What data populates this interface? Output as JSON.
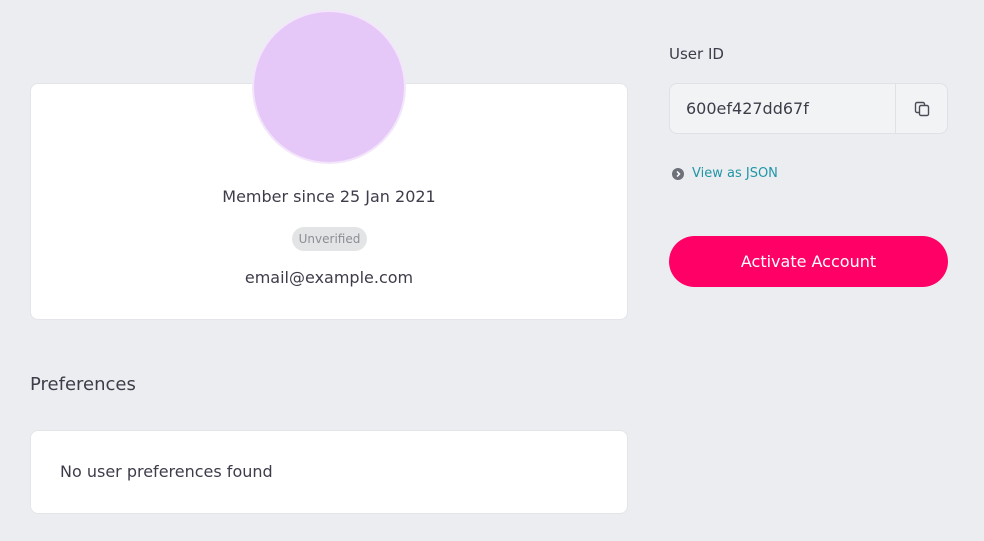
{
  "profile": {
    "member_since": "Member since 25 Jan 2021",
    "status_badge": "Unverified",
    "email": "email@example.com",
    "avatar_color": "#e6c8f8"
  },
  "preferences": {
    "title": "Preferences",
    "empty_message": "No user preferences found"
  },
  "user_id": {
    "label": "User ID",
    "value": "600ef427dd67f",
    "copy_icon": "copy-icon"
  },
  "links": {
    "view_json_label": "View as JSON",
    "view_json_icon": "chevron-circle-right-icon"
  },
  "actions": {
    "activate_label": "Activate Account",
    "activate_color": "#ff0066"
  }
}
